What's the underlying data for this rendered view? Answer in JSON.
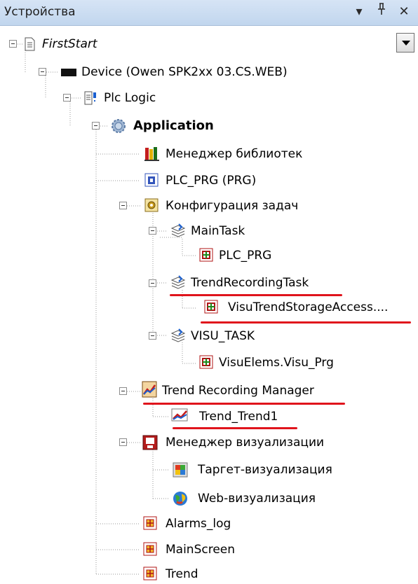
{
  "panel": {
    "title": "Устройства",
    "dropdown_glyph": "▾",
    "pin_glyph": "ᵖ",
    "close_glyph": "✕"
  },
  "tree": {
    "root": "FirstStart",
    "device": "Device (Owen SPK2xx 03.CS.WEB)",
    "plc_logic": "Plc Logic",
    "application": "Application",
    "library_manager": "Менеджер библиотек",
    "plc_prg": "PLC_PRG (PRG)",
    "task_config": "Конфигурация задач",
    "main_task": "MainTask",
    "main_task_call": "PLC_PRG",
    "trend_task": "TrendRecordingTask",
    "trend_task_call": "VisuTrendStorageAccess....",
    "visu_task": "VISU_TASK",
    "visu_task_call": "VisuElems.Visu_Prg",
    "trend_manager": "Trend Recording Manager",
    "trend_item": "Trend_Trend1",
    "visu_manager": "Менеджер визуализации",
    "target_visu": "Таргет-визуализация",
    "web_visu": "Web-визуализация",
    "alarms_log": "Alarms_log",
    "main_screen": "MainScreen",
    "trend": "Trend"
  }
}
